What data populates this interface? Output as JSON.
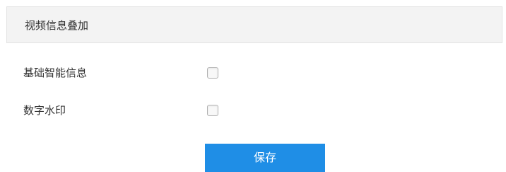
{
  "section": {
    "title": "视频信息叠加"
  },
  "options": [
    {
      "label": "基础智能信息",
      "checked": false
    },
    {
      "label": "数字水印",
      "checked": false
    }
  ],
  "actions": {
    "save_label": "保存"
  },
  "colors": {
    "accent": "#1f8ee6",
    "header_bg": "#f3f3f3",
    "text": "#333333"
  }
}
